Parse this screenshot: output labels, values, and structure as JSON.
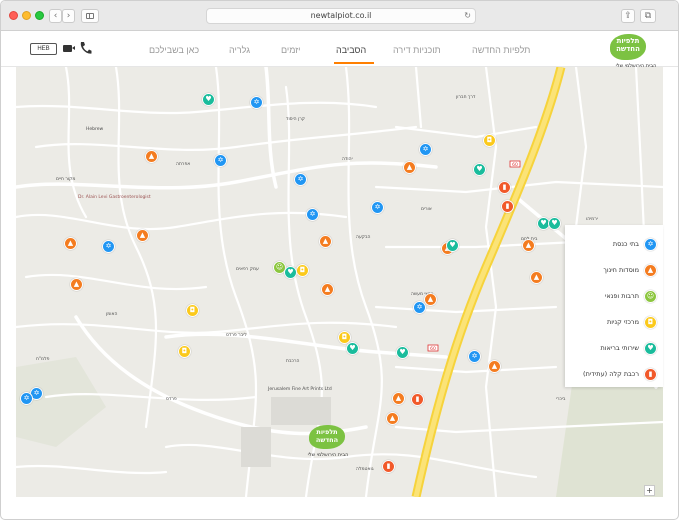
{
  "browser": {
    "url": "newtalpiot.co.il",
    "back_glyph": "‹",
    "forward_glyph": "›",
    "reload_glyph": "↻",
    "share_glyph": "⇪",
    "tabs_glyph": "⧉"
  },
  "header": {
    "lang": "HEB",
    "nav": [
      {
        "label": "תלפיות החדשה",
        "active": false
      },
      {
        "label": "תוכניות דירה",
        "active": false
      },
      {
        "label": "הסביבה",
        "active": true
      },
      {
        "label": "יזמים",
        "active": false
      },
      {
        "label": "גלריה",
        "active": false
      },
      {
        "label": "כאן בשבילכם",
        "active": false
      }
    ],
    "logo_title": "תלפיות החדשה",
    "logo_subtitle": "הבית הירושלמי שלי",
    "accent_color": "#ff7f00",
    "brand_color": "#7cc242",
    "icons": [
      "video-icon",
      "phone-icon"
    ]
  },
  "legend": {
    "items": [
      {
        "label": "בתי כנסת",
        "category": "synagogue",
        "icon": "star-of-david-icon",
        "color": "#2196f3"
      },
      {
        "label": "מוסדות חינוך",
        "category": "education",
        "icon": "graduation-cap-icon",
        "color": "#f47c20"
      },
      {
        "label": "תרבות ופנאי",
        "category": "culture",
        "icon": "mask-icon",
        "color": "#8cc63f"
      },
      {
        "label": "מרכזי קניות",
        "category": "shopping",
        "icon": "shopping-bag-icon",
        "color": "#fbc91b"
      },
      {
        "label": "שירותי בריאות",
        "category": "health",
        "icon": "stethoscope-icon",
        "color": "#1abc9c"
      },
      {
        "label": "רכבת קלה (עתידית)",
        "category": "rail",
        "icon": "train-icon",
        "color": "#f1592a"
      }
    ]
  },
  "map": {
    "zoom_label": "+",
    "logo_title": "תלפיות החדשה",
    "logo_subtitle": "הבית הירושלמי שלי",
    "route_badges": [
      "60",
      "60"
    ],
    "street_labels": [
      "דרך חברון",
      "בית לחם",
      "יהודה",
      "אפרתה",
      "הרכבת",
      "עמק רפאים",
      "Dr. Alain Levi Gastroenterologist",
      "Jerusalem Fine Art Prints Ltd",
      "Hebrew",
      "אורים",
      "ביכרי",
      "קרן היסוד",
      "האומן",
      "הבקעה",
      "ליבר פרדס",
      "אנשי מעשה",
      "פרדס",
      "פלמ\"ח",
      "ירמיהו",
      "גואטמלה",
      "מקור חיים"
    ],
    "pins": [
      {
        "category": "synagogue",
        "icon": "star-of-david-icon"
      },
      {
        "category": "education",
        "icon": "graduation-cap-icon"
      },
      {
        "category": "culture",
        "icon": "mask-icon"
      },
      {
        "category": "shopping",
        "icon": "shopping-bag-icon"
      },
      {
        "category": "health",
        "icon": "stethoscope-icon"
      },
      {
        "category": "rail",
        "icon": "train-icon"
      }
    ]
  },
  "glyphs": {
    "synagogue": "✡",
    "education": "▲",
    "culture": "☺",
    "shopping": "◘",
    "health": "♥",
    "rail": "▮"
  }
}
